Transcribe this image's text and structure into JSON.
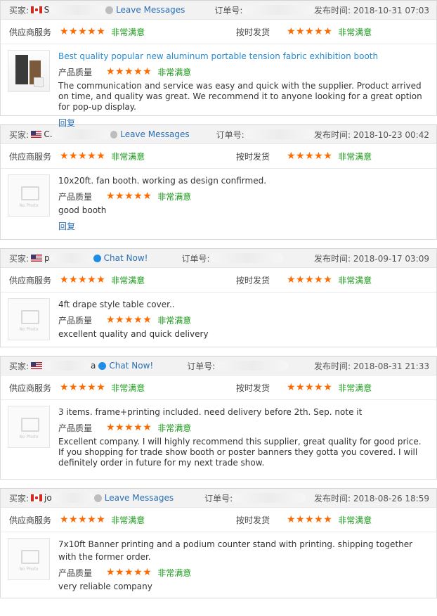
{
  "labels": {
    "buyer": "买家:",
    "order": "订单号:",
    "published": "发布时间:",
    "supplier_service": "供应商服务",
    "on_time_delivery": "按时发货",
    "product_quality": "产品质量",
    "very_satisfied": "非常满意",
    "stars": "★★★★★",
    "reply": "回复",
    "no_photo": "No Photo"
  },
  "reviews": [
    {
      "flag": "ca",
      "name": "S",
      "action": "Leave Messages",
      "date": "2018-10-31 07:03",
      "title": "Best quality popular new aluminum portable tension fabric exhibition booth",
      "comment": "The communication and service was easy and quick with the supplier. Product arrived on time, and quality was great. We recommend it to anyone looking for a great option for pop-up display.",
      "has_reply": true
    },
    {
      "flag": "us",
      "name": "C.",
      "action": "Leave Messages",
      "date": "2018-10-23 00:42",
      "title": "10x20ft. fan booth. working as design confirmed.",
      "comment": "good booth",
      "has_reply": true
    },
    {
      "flag": "us",
      "name": "p",
      "action": "Chat Now!",
      "date": "2018-09-17 03:09",
      "title": "4ft drape style table cover..",
      "comment": "excellent quality and quick delivery",
      "has_reply": false
    },
    {
      "flag": "us",
      "name": "",
      "name_suffix": "a",
      "action": "Chat Now!",
      "date": "2018-08-31 21:33",
      "title": "3 items. frame+printing included. need delivery before 2th. Sep. note it",
      "comment": "Excellent company. I will highly recommend this supplier, great quality for good price. If you shopping for trade show booth or poster banners they gotta you covered. I will definitely order in future for my next trade show.",
      "has_reply": false
    },
    {
      "flag": "ca",
      "name": "jo",
      "action": "Leave Messages",
      "date": "2018-08-26 18:59",
      "title": "7x10ft Banner printing and a podium counter stand with printing. shipping together with the former order.",
      "comment": "very reliable company",
      "has_reply": false
    }
  ]
}
